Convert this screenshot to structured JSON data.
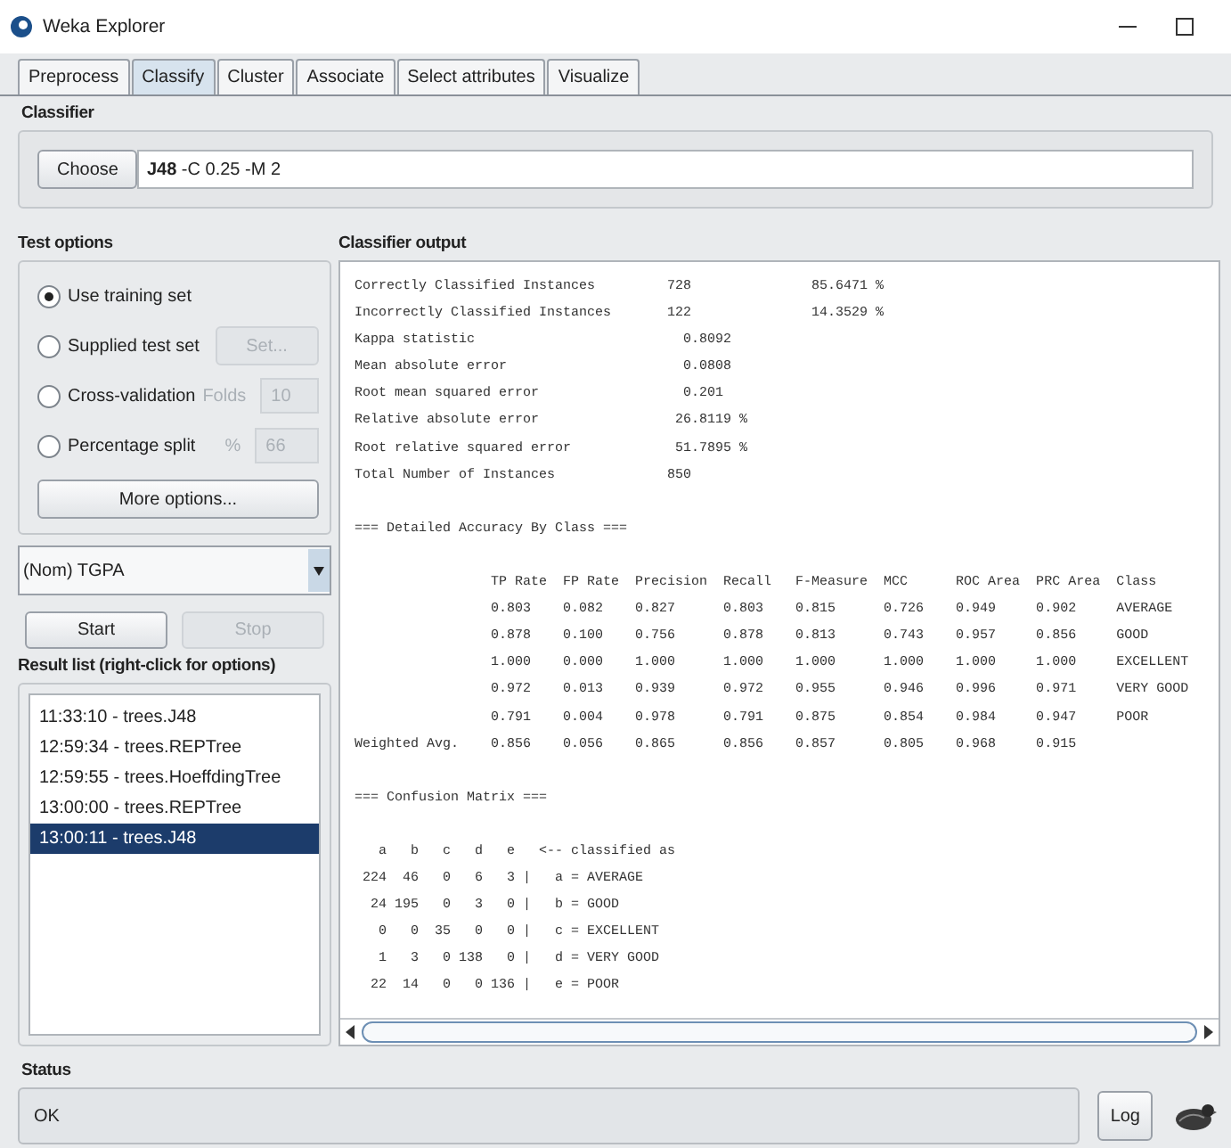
{
  "window": {
    "title": "Weka Explorer"
  },
  "tabs": [
    {
      "label": "Preprocess",
      "selected": false
    },
    {
      "label": "Classify",
      "selected": true
    },
    {
      "label": "Cluster",
      "selected": false
    },
    {
      "label": "Associate",
      "selected": false
    },
    {
      "label": "Select attributes",
      "selected": false
    },
    {
      "label": "Visualize",
      "selected": false
    }
  ],
  "classifier": {
    "heading": "Classifier",
    "choose_button": "Choose",
    "value": "**J48** -C 0.25 -M 2"
  },
  "test_options": {
    "heading": "Test options",
    "options": [
      {
        "label": "Use training set",
        "selected": true,
        "kind": "plain"
      },
      {
        "label": "Supplied test set",
        "selected": false,
        "kind": "button",
        "button": "Set...",
        "disabled": true
      },
      {
        "label": "Cross-validation",
        "selected": false,
        "kind": "field",
        "field_label": "Folds",
        "value": "10",
        "disabled": true
      },
      {
        "label": "Percentage split",
        "selected": false,
        "kind": "field",
        "field_label": "%",
        "value": "66",
        "disabled": true
      }
    ],
    "more_button": "More options..."
  },
  "class_dropdown": {
    "value": "(Nom) TGPA"
  },
  "run_buttons": [
    {
      "label": "Start",
      "disabled": false
    },
    {
      "label": "Stop",
      "disabled": true
    }
  ],
  "result_list": {
    "heading": "Result list (right-click for options)",
    "items": [
      {
        "label": "11:33:10 - trees.J48",
        "selected": false
      },
      {
        "label": "12:59:34 - trees.REPTree",
        "selected": false
      },
      {
        "label": "12:59:55 - trees.HoeffdingTree",
        "selected": false
      },
      {
        "label": "13:00:00 - trees.REPTree",
        "selected": false
      },
      {
        "label": "13:00:11 - trees.J48",
        "selected": true
      }
    ]
  },
  "classifier_output": {
    "heading": "Classifier output",
    "sections": [
      [
        "Correctly Classified Instances         728               85.6471 %",
        "Incorrectly Classified Instances       122               14.3529 %",
        "Kappa statistic                          0.8092",
        "Mean absolute error                      0.0808",
        "Root mean squared error                  0.201",
        "Relative absolute error                 26.8119 %",
        "Root relative squared error             51.7895 %",
        "Total Number of Instances              850"
      ],
      [
        "=== Detailed Accuracy By Class ==="
      ],
      [
        "                 TP Rate  FP Rate  Precision  Recall   F-Measure  MCC      ROC Area  PRC Area  Class",
        "                 0.803    0.082    0.827      0.803    0.815      0.726    0.949     0.902     AVERAGE",
        "                 0.878    0.100    0.756      0.878    0.813      0.743    0.957     0.856     GOOD",
        "                 1.000    0.000    1.000      1.000    1.000      1.000    1.000     1.000     EXCELLENT",
        "                 0.972    0.013    0.939      0.972    0.955      0.946    0.996     0.971     VERY GOOD",
        "                 0.791    0.004    0.978      0.791    0.875      0.854    0.984     0.947     POOR",
        "Weighted Avg.    0.856    0.056    0.865      0.856    0.857      0.805    0.968     0.915"
      ],
      [
        "=== Confusion Matrix ==="
      ],
      [
        "   a   b   c   d   e   <-- classified as",
        " 224  46   0   6   3 |   a = AVERAGE",
        "  24 195   0   3   0 |   b = GOOD",
        "   0   0  35   0   0 |   c = EXCELLENT",
        "   1   3   0 138   0 |   d = VERY GOOD",
        "  22  14   0   0 136 |   e = POOR"
      ]
    ]
  },
  "status": {
    "heading": "Status",
    "message": "OK",
    "log_button": "Log"
  }
}
